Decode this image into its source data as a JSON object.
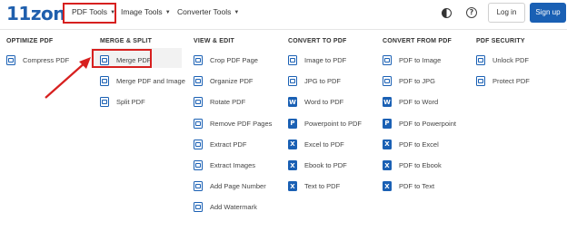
{
  "header": {
    "logo": "11zon",
    "nav": [
      {
        "label": "PDF Tools"
      },
      {
        "label": "Image Tools"
      },
      {
        "label": "Converter Tools"
      }
    ],
    "login_label": "Log in",
    "signup_label": "Sign up"
  },
  "columns": [
    {
      "heading": "OPTIMIZE PDF",
      "items": [
        {
          "label": "Compress PDF",
          "icon": "compress-icon"
        }
      ]
    },
    {
      "heading": "MERGE & SPLIT",
      "items": [
        {
          "label": "Merge PDF",
          "icon": "merge-icon"
        },
        {
          "label": "Merge PDF and Image",
          "icon": "merge-image-icon"
        },
        {
          "label": "Split PDF",
          "icon": "split-icon"
        }
      ]
    },
    {
      "heading": "VIEW & EDIT",
      "items": [
        {
          "label": "Crop PDF Page",
          "icon": "crop-icon"
        },
        {
          "label": "Organize PDF",
          "icon": "organize-icon"
        },
        {
          "label": "Rotate PDF",
          "icon": "rotate-icon"
        },
        {
          "label": "Remove PDF Pages",
          "icon": "remove-pages-icon"
        },
        {
          "label": "Extract PDF",
          "icon": "extract-icon"
        },
        {
          "label": "Extract Images",
          "icon": "extract-images-icon"
        },
        {
          "label": "Add Page Number",
          "icon": "page-number-icon"
        },
        {
          "label": "Add Watermark",
          "icon": "watermark-icon"
        }
      ]
    },
    {
      "heading": "CONVERT TO PDF",
      "items": [
        {
          "label": "Image to PDF",
          "icon": "image-icon",
          "glyph": ""
        },
        {
          "label": "JPG to PDF",
          "icon": "jpg-icon",
          "glyph": ""
        },
        {
          "label": "Word to PDF",
          "icon": "word-icon",
          "glyph": "W"
        },
        {
          "label": "Powerpoint to PDF",
          "icon": "powerpoint-icon",
          "glyph": "P"
        },
        {
          "label": "Excel to PDF",
          "icon": "excel-icon",
          "glyph": "X"
        },
        {
          "label": "Ebook to PDF",
          "icon": "ebook-icon",
          "glyph": "X"
        },
        {
          "label": "Text to PDF",
          "icon": "text-icon",
          "glyph": "X"
        }
      ]
    },
    {
      "heading": "CONVERT FROM PDF",
      "items": [
        {
          "label": "PDF to Image",
          "icon": "image-icon",
          "glyph": ""
        },
        {
          "label": "PDF to JPG",
          "icon": "jpg-icon",
          "glyph": ""
        },
        {
          "label": "PDF to Word",
          "icon": "word-icon",
          "glyph": "W"
        },
        {
          "label": "PDF to Powerpoint",
          "icon": "powerpoint-icon",
          "glyph": "P"
        },
        {
          "label": "PDF to Excel",
          "icon": "excel-icon",
          "glyph": "X"
        },
        {
          "label": "PDF to Ebook",
          "icon": "ebook-icon",
          "glyph": "X"
        },
        {
          "label": "PDF to Text",
          "icon": "text-icon",
          "glyph": "X"
        }
      ]
    },
    {
      "heading": "PDF SECURITY",
      "items": [
        {
          "label": "Unlock PDF",
          "icon": "unlock-icon"
        },
        {
          "label": "Protect PDF",
          "icon": "protect-icon"
        }
      ]
    }
  ],
  "colors": {
    "brand": "#1a60b4",
    "highlight": "#d7201f"
  }
}
